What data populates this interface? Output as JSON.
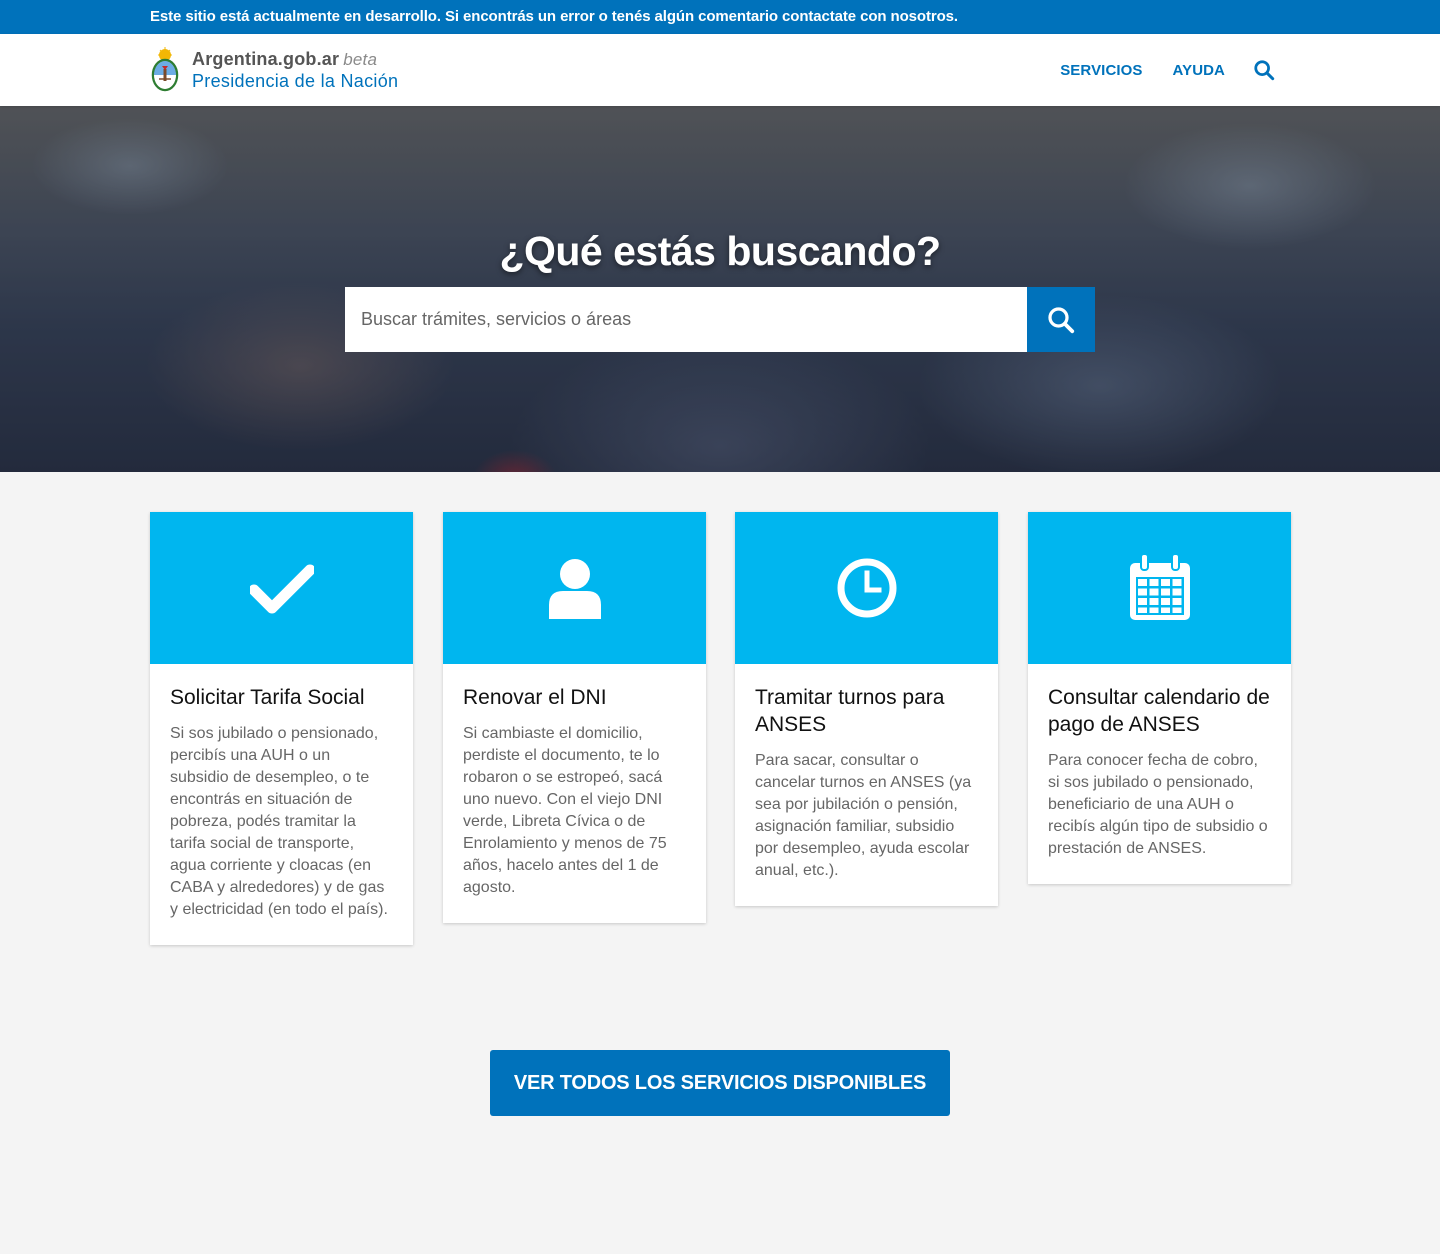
{
  "beta_bar": {
    "text": "Este sitio está actualmente en desarrollo. Si encontrás un error o tenés algún comentario contactate con nosotros."
  },
  "header": {
    "brand_name": "Argentina.gob.ar",
    "brand_beta": "beta",
    "brand_subtitle": "Presidencia de la Nación",
    "nav": [
      {
        "label": "SERVICIOS"
      },
      {
        "label": "AYUDA"
      }
    ]
  },
  "hero": {
    "title": "¿Qué estás buscando?",
    "search_placeholder": "Buscar trámites, servicios o áreas"
  },
  "cards": [
    {
      "icon": "checkmark-icon",
      "title": "Solicitar Tarifa Social",
      "description": "Si sos jubilado o pensionado, percibís una AUH o un subsidio de desempleo, o te encontrás en situación de pobreza, podés tramitar la tarifa social de transporte, agua corriente y cloacas (en CABA y alrededores) y de gas y electricidad (en todo el país)."
    },
    {
      "icon": "user-icon",
      "title": "Renovar el DNI",
      "description": "Si cambiaste el domicilio, perdiste el documento, te lo robaron o se estropeó, sacá uno nuevo. Con el viejo DNI verde, Libreta Cívica o de Enrolamiento y menos de 75 años, hacelo antes del 1 de agosto."
    },
    {
      "icon": "clock-icon",
      "title": "Tramitar turnos para ANSES",
      "description": "Para sacar, consultar o cancelar turnos en ANSES (ya sea por jubilación o pensión, asignación familiar, subsidio por desempleo, ayuda escolar anual, etc.)."
    },
    {
      "icon": "calendar-icon",
      "title": "Consultar calendario de pago de ANSES",
      "description": "Para conocer fecha de cobro, si sos jubilado o pensionado, beneficiario de una AUH o recibís algún tipo de subsidio o prestación de ANSES."
    }
  ],
  "cta": {
    "label": "VER TODOS LOS SERVICIOS DISPONIBLES"
  },
  "colors": {
    "primary": "#0072bb",
    "accent": "#00b6ef",
    "background": "#f4f4f4"
  }
}
